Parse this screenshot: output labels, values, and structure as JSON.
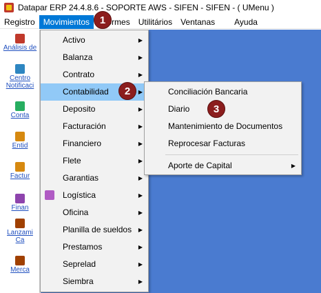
{
  "title": "Datapar ERP 24.4.8.6 - SOPORTE AWS - SIFEN - SIFEN -  ( UMenu )",
  "menubar": {
    "items": [
      "Registro",
      "Movimientos",
      "Informes",
      "Utilitários",
      "Ventanas",
      "Ayuda"
    ],
    "visible_informes_fragment": "formes"
  },
  "sidebar": {
    "items": [
      {
        "label": "Análisis de",
        "icon": "analysis-icon",
        "color": "#c0392b"
      },
      {
        "label": "Centro de Notificaciones",
        "line1": "Centro",
        "line2": "Notificaci",
        "icon": "notification-icon",
        "color": "#2e86c1"
      },
      {
        "label": "Contabilidad",
        "line1": "Conta",
        "icon": "accounting-icon",
        "color": "#27ae60"
      },
      {
        "label": "Entidades",
        "line1": "Entid",
        "icon": "entity-icon",
        "color": "#d68910"
      },
      {
        "label": "Facturación",
        "line1": "Factur",
        "icon": "invoice-icon",
        "color": "#d68910"
      },
      {
        "label": "Financiero",
        "line1": "Finan",
        "icon": "finance-icon",
        "color": "#8e44ad"
      },
      {
        "label": "Lanzamientos de Caja",
        "line1": "Lanzami",
        "line2": "Ca",
        "icon": "cash-icon",
        "color": "#a04000"
      },
      {
        "label": "Mercaderías",
        "line1": "Merca",
        "icon": "goods-icon",
        "color": "#a04000"
      }
    ]
  },
  "movimientos_menu": {
    "items": [
      {
        "label": "Activo",
        "has_submenu": true
      },
      {
        "label": "Balanza",
        "has_submenu": true
      },
      {
        "label": "Contrato",
        "has_submenu": true
      },
      {
        "label": "Contabilidad",
        "has_submenu": true,
        "highlighted": true
      },
      {
        "label": "Deposito",
        "has_submenu": true
      },
      {
        "label": "Facturación",
        "has_submenu": true
      },
      {
        "label": "Financiero",
        "has_submenu": true
      },
      {
        "label": "Flete",
        "has_submenu": true
      },
      {
        "label": "Garantias",
        "has_submenu": true
      },
      {
        "label": "Logística",
        "has_submenu": true,
        "icon": "book-icon"
      },
      {
        "label": "Oficina",
        "has_submenu": true
      },
      {
        "label": "Planilla de sueldos",
        "has_submenu": true
      },
      {
        "label": "Prestamos",
        "has_submenu": true
      },
      {
        "label": "Seprelad",
        "has_submenu": true
      },
      {
        "label": "Siembra",
        "has_submenu": true
      }
    ]
  },
  "contabilidad_submenu": {
    "items": [
      {
        "label": "Conciliación Bancaria"
      },
      {
        "label": "Diario"
      },
      {
        "label": "Mantenimiento de Documentos"
      },
      {
        "label": "Reprocesar Facturas"
      },
      {
        "label": "Aporte de Capital",
        "has_submenu": true
      }
    ]
  },
  "badges": [
    "1",
    "2",
    "3"
  ],
  "colors": {
    "desktop": "#4a7bd0",
    "menubar_active": "#0078d7",
    "menu_highlight": "#91c9f7",
    "badge": "#8b1d1d"
  }
}
